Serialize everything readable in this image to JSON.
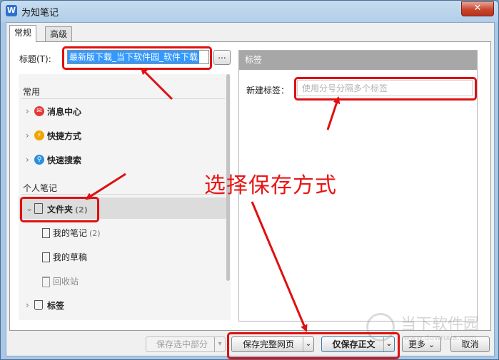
{
  "window": {
    "title": "为知笔记",
    "app_icon_letter": "W",
    "close_glyph": "✕"
  },
  "tabs": [
    {
      "label": "常规"
    },
    {
      "label": "高级"
    }
  ],
  "form": {
    "title_label": "标题(T):",
    "title_value": "最新版下载_当下软件园_软件下载",
    "browse_label": "..."
  },
  "sidebar": {
    "common_header": "常用",
    "common_items": [
      {
        "label": "消息中心",
        "icon": "message-center-icon",
        "color": "#e23a3a"
      },
      {
        "label": "快捷方式",
        "icon": "shortcut-icon",
        "color": "#f0a500"
      },
      {
        "label": "快速搜索",
        "icon": "quick-search-icon",
        "color": "#2a8fe0"
      }
    ],
    "personal_header": "个人笔记",
    "folder": {
      "label": "文件夹",
      "count": "(2)"
    },
    "folder_children": [
      {
        "label": "我的笔记",
        "count": "(2)",
        "icon": "note-icon"
      },
      {
        "label": "我的草稿",
        "count": "",
        "icon": "draft-icon"
      },
      {
        "label": "回收站",
        "count": "",
        "icon": "trash-icon"
      }
    ],
    "tags_item": {
      "label": "标签",
      "icon": "tag-icon"
    }
  },
  "tags_panel": {
    "header": "标签",
    "new_tag_label": "新建标签：",
    "new_tag_placeholder": "使用分号分隔多个标签"
  },
  "buttons": {
    "save_selection": "保存选中部分",
    "save_full": "保存完整网页",
    "save_body": "仅保存正文",
    "more": "更多",
    "cancel": "取消"
  },
  "annotation": {
    "text": "选择保存方式",
    "color": "#e81515"
  },
  "watermark": {
    "brand": "当下软件园",
    "url": "www.downxia.com"
  }
}
